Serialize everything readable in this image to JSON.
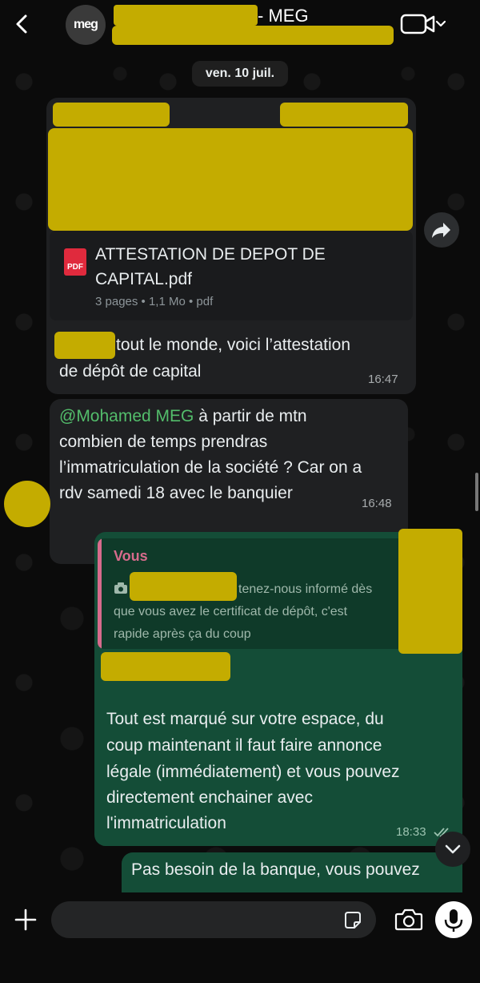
{
  "header": {
    "title_suffix": "- MEG",
    "avatar_text": "meg"
  },
  "chat": {
    "date": "ven. 10 juil.",
    "messages": [
      {
        "file": {
          "name": "ATTESTATION DE DEPOT DE CAPITAL.pdf",
          "icon_label": "PDF",
          "meta": "3 pages • 1,1 Mo • pdf"
        },
        "text_line1": "tout le monde, voici l’attestation",
        "text_line2": "de dépôt de capital",
        "time": "16:47"
      },
      {
        "mention": "@Mohamed MEG",
        "text_after_mention": " à partir de mtn",
        "text_lines": [
          "combien de temps prendras",
          "l’immatriculation de la société ? Car on a",
          "rdv samedi 18 avec le banquier"
        ],
        "time": "16:48"
      },
      {
        "reply": {
          "author": "Vous",
          "line1": "tenez-nous informé dès",
          "line2": "que vous avez le certificat de dépôt, c'est",
          "line3": "rapide après ça du coup"
        },
        "text_lines": [
          "Tout est marqué sur votre espace, du",
          "coup maintenant il faut faire annonce",
          "légale (immédiatement) et vous pouvez",
          "directement enchainer avec",
          "l'immatriculation"
        ],
        "time": "18:33"
      },
      {
        "text_line1": "Pas besoin de la banque, vous pouvez"
      }
    ]
  },
  "composer": {
    "placeholder": ""
  },
  "colors": {
    "incoming_bubble": "#1f2022",
    "outgoing_bubble": "#144d37",
    "mention": "#53bd6b",
    "reply_author": "#d76b8c",
    "redaction": "#c4ac00"
  },
  "icons": [
    "back-icon",
    "video-camera-icon",
    "chevron-down-icon",
    "pdf-icon",
    "forward-icon",
    "camera-icon",
    "double-check-icon",
    "plus-icon",
    "sticker-icon",
    "microphone-icon"
  ]
}
